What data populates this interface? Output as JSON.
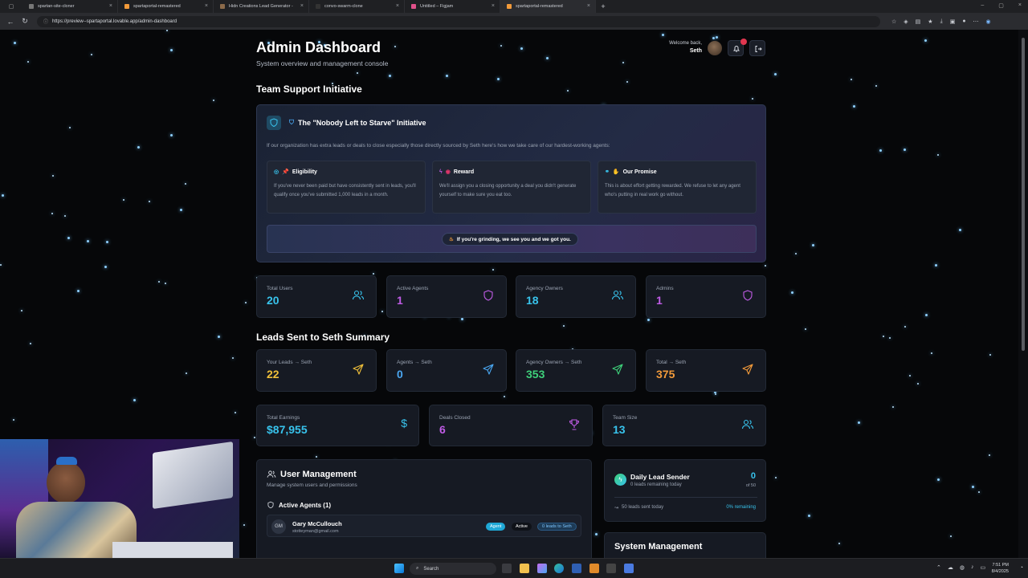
{
  "browser": {
    "tabs": [
      {
        "label": "spartan-site-cloner",
        "active": false
      },
      {
        "label": "spartaportal-remastered",
        "active": false
      },
      {
        "label": "Hidn Creations Lead Generator -",
        "active": false
      },
      {
        "label": "convo-swarm-clone",
        "active": false
      },
      {
        "label": "Untitled – Figjam",
        "active": false
      },
      {
        "label": "spartaportal-remastered",
        "active": true
      }
    ],
    "new_tab": "+",
    "url": "https://preview--spartaportal.lovable.app/admin-dashboard"
  },
  "header": {
    "title": "Admin Dashboard",
    "subtitle": "System overview and management console",
    "welcome": "Welcome back,",
    "user": "Seth"
  },
  "team_support": {
    "section_title": "Team Support Initiative",
    "card_title": "The \"Nobody Left to Starve\" Initiative",
    "intro": "If our organization has extra leads or deals to close especially those directly sourced by Seth here's how we take care of our hardest-working agents:",
    "cards": [
      {
        "title": "Eligibility",
        "text": "If you've never been paid but have consistently sent in leads, you'll qualify once you've submitted 1,000 leads in a month."
      },
      {
        "title": "Reward",
        "text": "We'll assign you a closing opportunity a deal you didn't generate yourself to make sure you eat too."
      },
      {
        "title": "Our Promise",
        "text": "This is about effort getting rewarded. We refuse to let any agent who's putting in real work go without."
      }
    ],
    "banner": "If you're grinding, we see you and we got you."
  },
  "stats_users": [
    {
      "label": "Total Users",
      "value": "20",
      "color": "#38c3ec"
    },
    {
      "label": "Active Agents",
      "value": "1",
      "color": "#c05ce6"
    },
    {
      "label": "Agency Owners",
      "value": "18",
      "color": "#38c3ec"
    },
    {
      "label": "Admins",
      "value": "1",
      "color": "#c05ce6"
    }
  ],
  "leads_summary": {
    "section_title": "Leads Sent to Seth Summary",
    "items": [
      {
        "label": "Your Leads → Seth",
        "value": "22",
        "color": "#f0c03a"
      },
      {
        "label": "Agents → Seth",
        "value": "0",
        "color": "#4aa6f0"
      },
      {
        "label": "Agency Owners → Seth",
        "value": "353",
        "color": "#3ed07a"
      },
      {
        "label": "Total → Seth",
        "value": "375",
        "color": "#f29a3a"
      }
    ]
  },
  "stats_business": [
    {
      "label": "Total Earnings",
      "value": "$87,955",
      "color": "#38c3ec"
    },
    {
      "label": "Deals Closed",
      "value": "6",
      "color": "#c05ce6"
    },
    {
      "label": "Team Size",
      "value": "13",
      "color": "#38c3ec"
    }
  ],
  "user_management": {
    "title": "User Management",
    "subtitle": "Manage system users and permissions",
    "active_agents_label": "Active Agents (1)",
    "agent": {
      "initials": "GM",
      "name": "Gary McCullouch",
      "email": "stotteyman@gmail.com",
      "role_badge": "Agent",
      "status": "Active",
      "leads_badge": "0 leads to Seth"
    }
  },
  "daily_lead_sender": {
    "title": "Daily Lead Sender",
    "remaining_text": "0 leads remaining today",
    "count": "0",
    "of_total": "of 50",
    "sent_text": "50 leads sent today",
    "percent_text": "0% remaining"
  },
  "system_management": {
    "title": "System Management"
  },
  "taskbar": {
    "search": "Search",
    "time": "7:51 PM",
    "date": "8/4/2025"
  }
}
